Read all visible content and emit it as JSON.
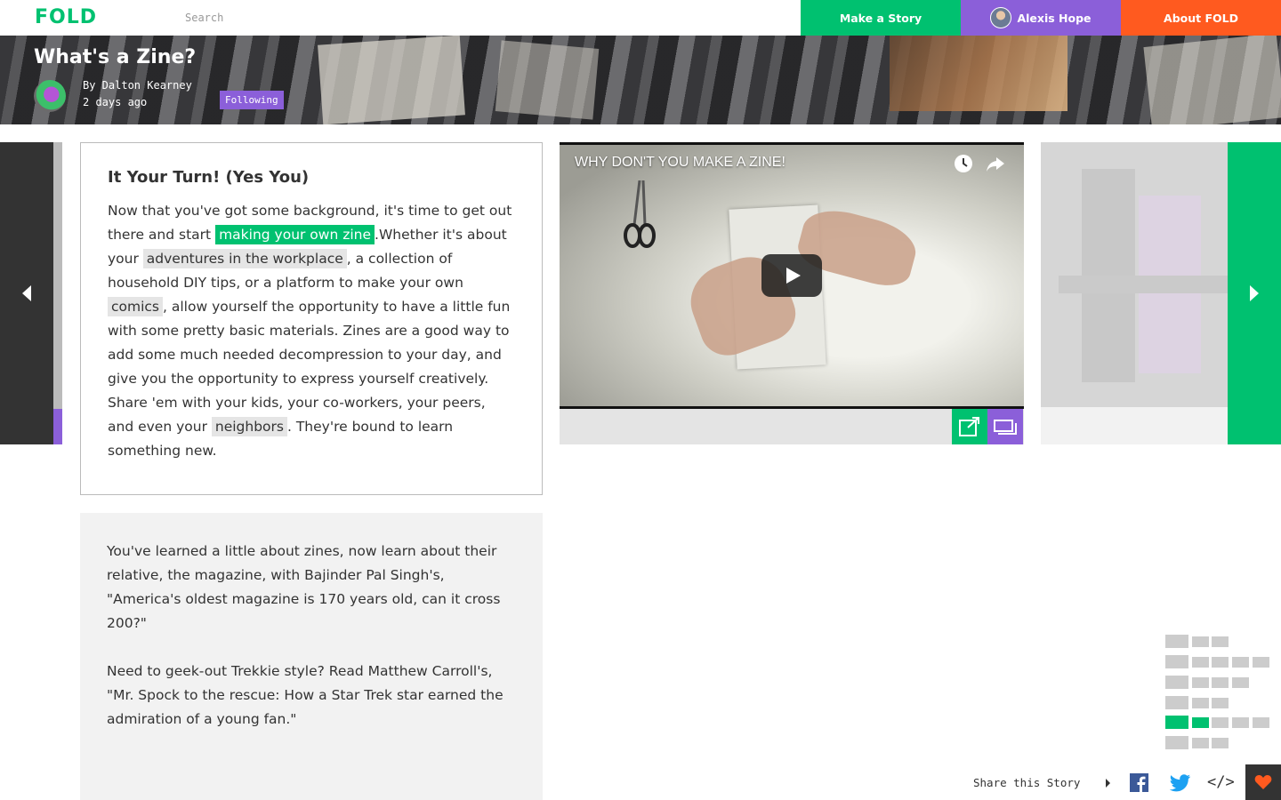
{
  "nav": {
    "logo": "FOLD",
    "search_placeholder": "Search",
    "make_story": "Make a Story",
    "user_name": "Alexis Hope",
    "about": "About FOLD"
  },
  "header": {
    "title": "What's a Zine?",
    "author": "By Dalton Kearney",
    "time": "2 days ago",
    "follow_label": "Following"
  },
  "card_main": {
    "heading": "It Your Turn! (Yes You)",
    "t1": "Now that you've got some background, it's time to get out there and start ",
    "link1": "making your own zine",
    "t2": ".Whether it's about your ",
    "link2": "adventures in the workplace",
    "t3": ", a collection of household DIY tips, or a platform to make your own ",
    "link3": "comics",
    "t4": ", allow yourself the opportunity to have a little fun with some pretty basic materials. Zines are a good way to add some much needed decompression to your day, and give you the opportunity to express yourself creatively. Share 'em with your kids, your co-workers, your peers, and even your ",
    "link4": "neighbors",
    "t5": ". They're bound to learn something new."
  },
  "card_related": {
    "p1": "You've learned a little about zines, now learn about their relative, the magazine, with Bajinder Pal Singh's,  \"America's oldest magazine is 170 years old, can it cross 200?\"",
    "p2": "Need to geek-out Trekkie style? Read Matthew Carroll's,  \"Mr. Spock to the rescue: How a Star Trek star earned the admiration of a young fan.\""
  },
  "video": {
    "title": "WHY DON'T YOU MAKE A ZINE!"
  },
  "share": {
    "label": "Share this Story",
    "embed": "</>"
  },
  "colors": {
    "green": "#00c170",
    "purple": "#8b5fd9",
    "orange": "#ff5a1f",
    "dark": "#333333",
    "heart": "#ff5a1f"
  },
  "icons": [
    "search-icon",
    "clock-icon",
    "share-arrow-icon",
    "play-icon",
    "expand-icon",
    "stack-icon",
    "facebook-icon",
    "twitter-icon",
    "embed-icon",
    "heart-icon",
    "chevron-left-icon",
    "chevron-right-icon"
  ]
}
